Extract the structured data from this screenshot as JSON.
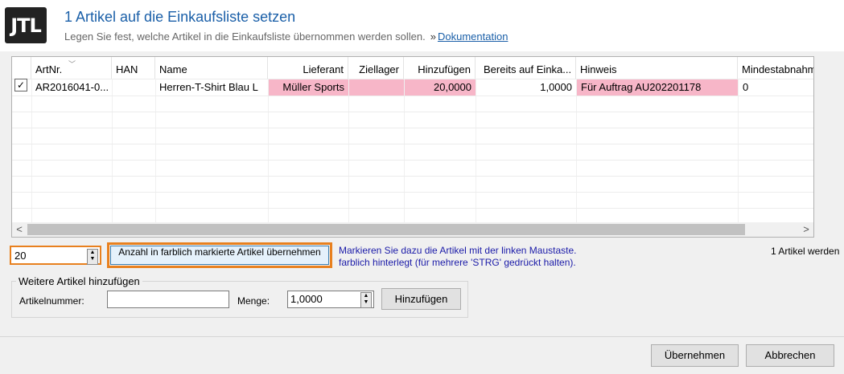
{
  "header": {
    "logo_text": "JTL",
    "title": "1 Artikel auf die Einkaufsliste setzen",
    "subtitle": "Legen Sie fest, welche Artikel in die Einkaufsliste übernommen werden sollen.",
    "link_prefix": "»",
    "link_label": "Dokumentation"
  },
  "grid": {
    "columns": [
      "ArtNr.",
      "HAN",
      "Name",
      "Lieferant",
      "Ziellager",
      "Hinzufügen",
      "Bereits auf Einka...",
      "Hinweis",
      "Mindestabnahme"
    ],
    "rows": [
      {
        "checked": true,
        "check_mark": "✓",
        "artnr": "AR2016041-0...",
        "han": "",
        "name": "Herren-T-Shirt Blau L",
        "lieferant": "Müller Sports",
        "ziellager": "",
        "hinzufuegen": "20,0000",
        "bereits": "1,0000",
        "hinweis": "Für Auftrag  AU202201178",
        "mindestabnahme": "0"
      }
    ],
    "scroll_left": "<",
    "scroll_right": ">",
    "highlight_color": "#f7b6c8"
  },
  "quantity": {
    "value": "20",
    "up": "▲",
    "down": "▼"
  },
  "apply_button": {
    "label": "Anzahl in farblich markierte Artikel übernehmen"
  },
  "hint": {
    "line1": "Markieren Sie dazu die Artikel mit der linken Maustaste.",
    "line2": "farblich hinterlegt (für mehrere 'STRG' gedrückt halten)."
  },
  "count_text": "1 Artikel werden",
  "add_section": {
    "title": "Weitere Artikel hinzufügen",
    "artnr_label": "Artikelnummer:",
    "artnr_value": "",
    "menge_label": "Menge:",
    "menge_value": "1,0000",
    "add_button": "Hinzufügen"
  },
  "footer": {
    "ok_button": "Übernehmen",
    "cancel_button": "Abbrechen"
  },
  "colors": {
    "accent": "#1a5fa8",
    "orange_highlight": "#e8801e"
  }
}
